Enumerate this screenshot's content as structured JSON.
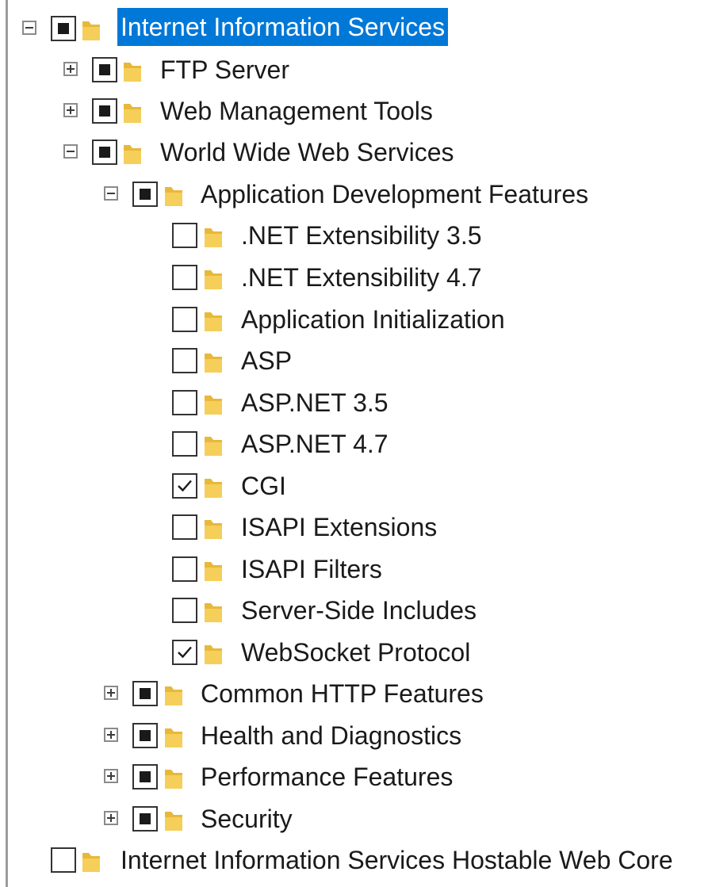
{
  "tree": {
    "root": {
      "label": "Internet Information Services",
      "state": "partial",
      "expanded": true,
      "selected": true
    },
    "ftp_server": {
      "label": "FTP Server",
      "state": "partial",
      "expanded": false
    },
    "web_management_tools": {
      "label": "Web Management Tools",
      "state": "partial",
      "expanded": false
    },
    "www_services": {
      "label": "World Wide Web Services",
      "state": "partial",
      "expanded": true
    },
    "app_dev_features": {
      "label": "Application Development Features",
      "state": "partial",
      "expanded": true,
      "items": [
        {
          "label": ".NET Extensibility 3.5",
          "checked": false
        },
        {
          "label": ".NET Extensibility 4.7",
          "checked": false
        },
        {
          "label": "Application Initialization",
          "checked": false
        },
        {
          "label": "ASP",
          "checked": false
        },
        {
          "label": "ASP.NET 3.5",
          "checked": false
        },
        {
          "label": "ASP.NET 4.7",
          "checked": false
        },
        {
          "label": "CGI",
          "checked": true
        },
        {
          "label": "ISAPI Extensions",
          "checked": false
        },
        {
          "label": "ISAPI Filters",
          "checked": false
        },
        {
          "label": "Server-Side Includes",
          "checked": false
        },
        {
          "label": "WebSocket Protocol",
          "checked": true
        }
      ]
    },
    "common_http_features": {
      "label": "Common HTTP Features",
      "state": "partial",
      "expanded": false
    },
    "health_and_diagnostics": {
      "label": "Health and Diagnostics",
      "state": "partial",
      "expanded": false
    },
    "performance_features": {
      "label": "Performance Features",
      "state": "partial",
      "expanded": false
    },
    "security": {
      "label": "Security",
      "state": "partial",
      "expanded": false
    },
    "hostable_web_core": {
      "label": "Internet Information Services Hostable Web Core",
      "state": "unchecked"
    }
  },
  "colors": {
    "selection": "#0078d7",
    "folder": "#f5cf5a",
    "folder_shade": "#e8b83a",
    "text": "#1a1a1a"
  },
  "icons": {
    "folder": "folder-icon",
    "expand": "plus-icon",
    "collapse": "minus-icon",
    "check": "checkmark-icon"
  }
}
